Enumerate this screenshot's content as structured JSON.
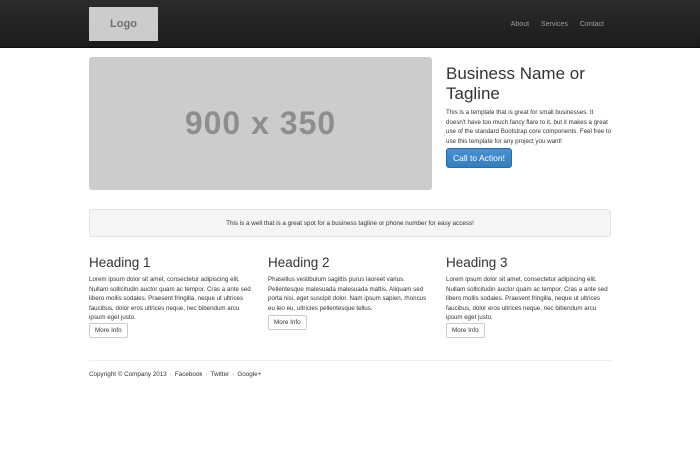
{
  "navbar": {
    "logo": "Logo",
    "links": [
      "About",
      "Services",
      "Contact"
    ]
  },
  "hero": {
    "image_placeholder": "900 x 350",
    "title": "Business Name or Tagline",
    "description": "This is a template that is great for small businesses. It doesn't have too much fancy flare to it, but it makes a great use of the standard Bootstrap core components. Feel free to use this template for any project you want!",
    "cta_label": "Call to Action!"
  },
  "well": {
    "text": "This is a well that is a great spot for a business tagline or phone number for easy access!"
  },
  "columns": [
    {
      "heading": "Heading 1",
      "text": "Lorem ipsum dolor sit amet, consectetur adipiscing elit. Nullam sollicitudin auctor quam ac tempor. Cras a ante sed libero mollis sodales. Praesent fringilla, neque ut ultrices faucibus, dolor eros ultrices neque, nec bibendum arcu ipsum eget justo.",
      "button": "More Info"
    },
    {
      "heading": "Heading 2",
      "text": "Phasellus vestibulum sagittis purus laoreet varius. Pellentesque malesuada malesuada mattis. Aliquam sed porta nisi, eget suscipit dolor. Nam ipsum sapien, rhoncus eu leo eu, ultricies pellentesque tellus.",
      "button": "More Info"
    },
    {
      "heading": "Heading 3",
      "text": "Lorem ipsum dolor sit amet, consectetur adipiscing elit. Nullam sollicitudin auctor quam ac tempor. Cras a ante sed libero mollis sodales. Praesent fringilla, neque ut ultrices faucibus, dolor eros ultrices neque, nec bibendum arcu ipsum eget justo.",
      "button": "More Info"
    }
  ],
  "footer": {
    "copyright": "Copyright © Company 2013",
    "links": [
      "Facebook",
      "Twitter",
      "Google+"
    ],
    "separator": "·"
  }
}
